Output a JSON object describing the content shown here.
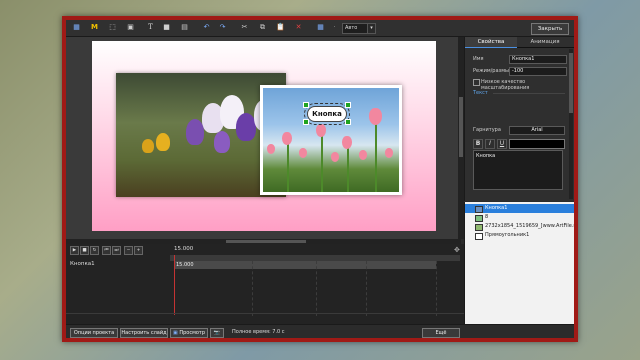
{
  "toolbar": {
    "zoom_value": "Авто",
    "close_label": "Закрыть",
    "icons": [
      "app-logo-icon",
      "logo-m-icon",
      "select-icon",
      "media-icon",
      "text-icon",
      "rectangle-icon",
      "image-icon",
      "undo-icon",
      "redo-icon",
      "cut-icon",
      "copy-icon",
      "paste-icon",
      "delete-icon",
      "grid-icon"
    ]
  },
  "canvas": {
    "button_text": "Кнопка"
  },
  "properties": {
    "tab_properties": "Свойства",
    "tab_animation": "Анимация",
    "name_label": "Имя",
    "name_value": "Кнопка1",
    "mode_label": "Режим/размыть",
    "mode_value": "-100",
    "lowquality_label": "Низкое качество масштабирования",
    "section_text": "Текст",
    "font_label": "Гарнитура",
    "font_value": "Arial",
    "bold": "B",
    "italic": "I",
    "underline": "U",
    "text_value": "Кнопка"
  },
  "layers": [
    {
      "name": "Кнопка1",
      "selected": true
    },
    {
      "name": "8",
      "selected": false
    },
    {
      "name": "2732x1854_1519659_[www.ArtFile.ru]",
      "selected": false
    },
    {
      "name": "Прямоугольник1",
      "selected": false
    }
  ],
  "timeline": {
    "time_display": "15.000",
    "row_label": "Кнопка1",
    "track_value": "15.000"
  },
  "bottom": {
    "project_options": "Опции проекта",
    "slide_settings": "Настроить слайд",
    "preview": "Просмотр",
    "total_time": "Полное время: 7.0 с",
    "done": "Ещё"
  }
}
